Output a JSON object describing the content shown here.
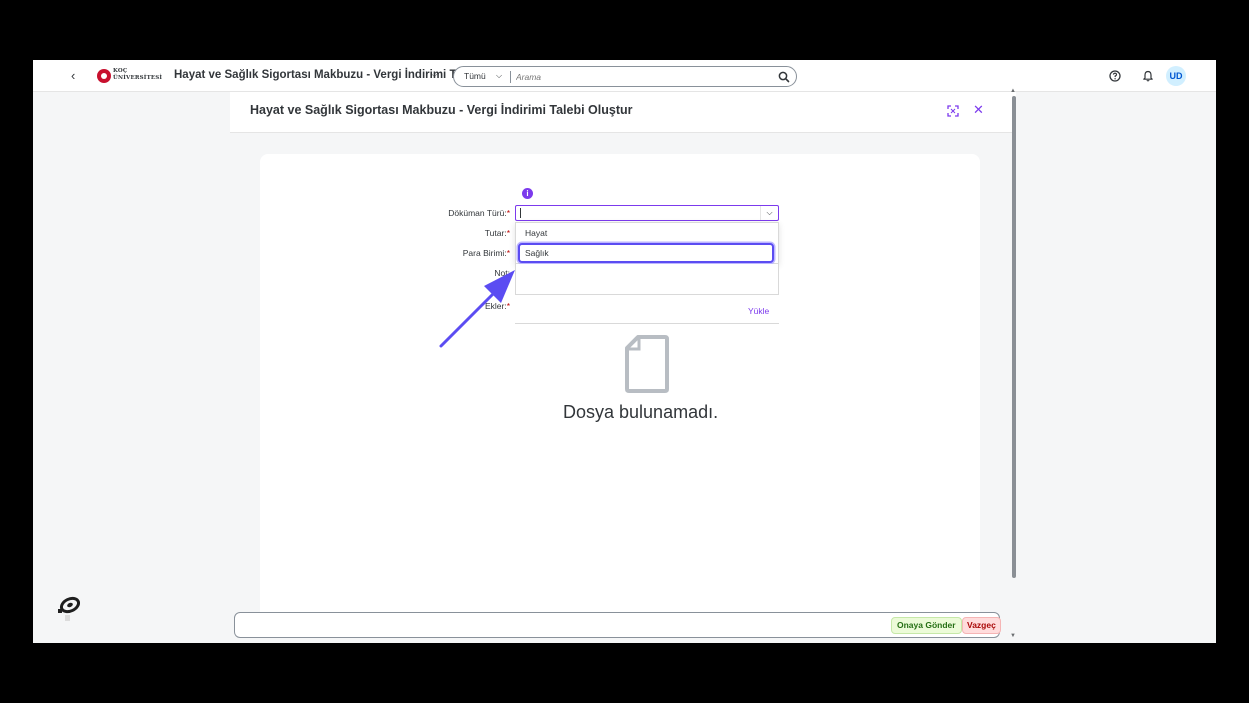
{
  "shellbar": {
    "logo_text_line1": "KOÇ",
    "logo_text_line2": "ÜNİVERSİTESİ",
    "app_title": "Hayat ve Sağlık Sigortası Makbuzu - Vergi İndirimi Ta...",
    "search_scope": "Tümü",
    "search_placeholder": "Arama",
    "avatar_initials": "UD"
  },
  "dialog": {
    "title": "Hayat ve Sağlık Sigortası Makbuzu - Vergi İndirimi Talebi Oluştur"
  },
  "form": {
    "info_symbol": "i",
    "required_marker": "*",
    "labels": {
      "document_type": "Döküman Türü:",
      "amount": "Tutar:",
      "currency": "Para Birimi:",
      "note": "Not:",
      "attachments": "Ekler:"
    },
    "document_type_value": "",
    "dropdown_options": [
      "Hayat",
      "Sağlık"
    ],
    "selected_option_index": 1,
    "upload_label": "Yükle"
  },
  "attachments": {
    "empty_message": "Dosya bulunamadı."
  },
  "footer": {
    "send_label": "Onaya Gönder",
    "cancel_label": "Vazgeç"
  },
  "colors": {
    "accent": "#7c3aed",
    "highlight_border": "#5b4cf2",
    "arrow": "#5b4cf2",
    "send_bg": "#ecfbd8",
    "cancel_bg": "#ffdcdc"
  }
}
